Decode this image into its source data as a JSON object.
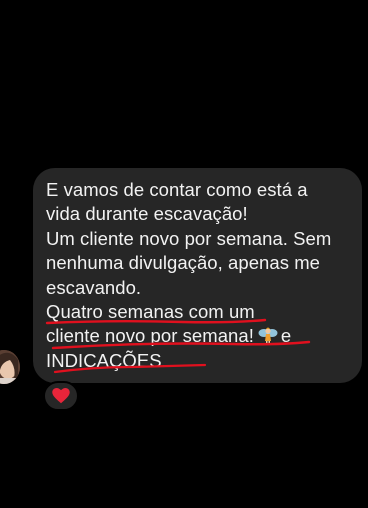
{
  "message": {
    "lines": [
      "E vamos de contar como está a",
      "vida durante escavação!",
      "Um cliente novo por semana. Sem",
      "nenhuma divulgação, apenas me",
      "escavando.",
      "Quatro semanas com um",
      "cliente novo por semana!",
      "e",
      "INDICAÇÕES."
    ],
    "inline_emoji": "fairy-emoji",
    "underline_color": "#e0101e"
  },
  "reaction": {
    "icon": "red-heart-icon",
    "color": "#e8253a"
  },
  "colors": {
    "background": "#000000",
    "bubble": "#262626",
    "text": "#f2f2f2"
  }
}
